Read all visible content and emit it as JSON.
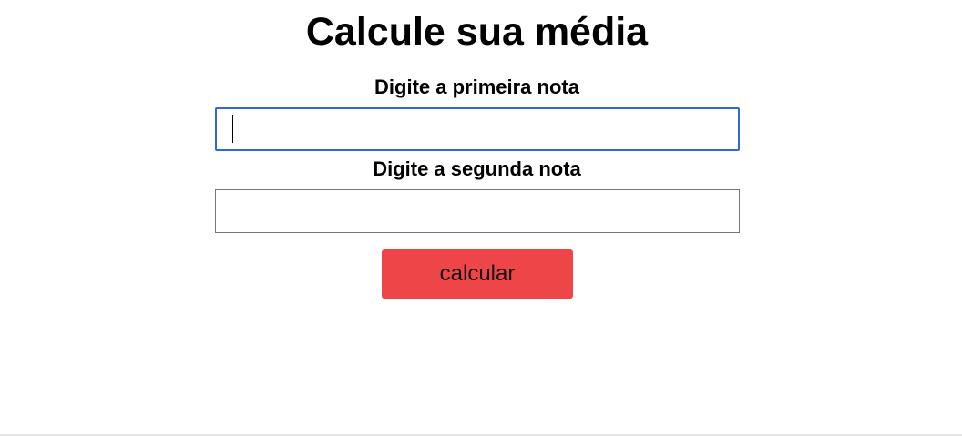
{
  "page": {
    "title": "Calcule sua média"
  },
  "form": {
    "first_grade": {
      "label": "Digite a primeira nota",
      "value": ""
    },
    "second_grade": {
      "label": "Digite a segunda nota",
      "value": ""
    },
    "submit_label": "calcular"
  },
  "colors": {
    "button_background": "#ee4549",
    "focus_border": "#2f68d9"
  }
}
